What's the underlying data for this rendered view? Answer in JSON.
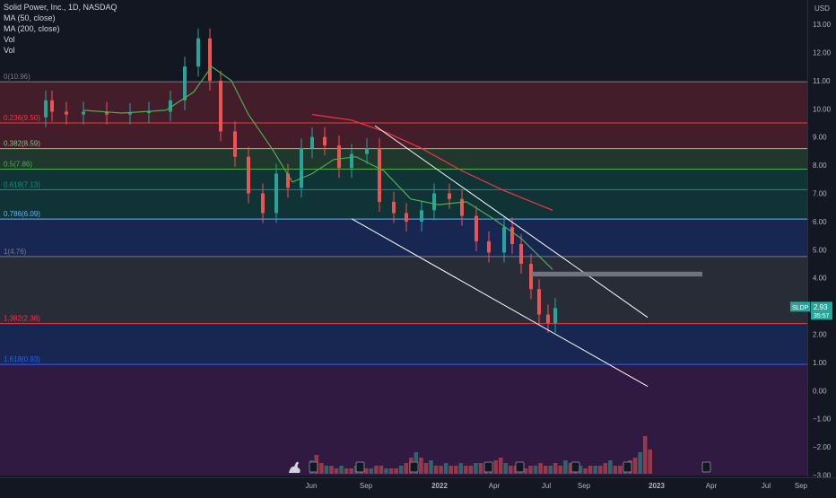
{
  "header": {
    "title": "Solid Power, Inc., 1D, NASDAQ",
    "indicators": [
      "MA (50, close)",
      "MA (200, close)",
      "Vol",
      "Vol"
    ]
  },
  "price_axis": {
    "unit": "USD",
    "ticks": [
      "13.00",
      "12.00",
      "11.00",
      "10.00",
      "9.00",
      "8.00",
      "7.00",
      "6.00",
      "5.00",
      "4.00",
      "3.00",
      "2.00",
      "1.00",
      "0.00",
      "−1.00",
      "−2.00",
      "−3.00"
    ]
  },
  "time_axis": {
    "ticks": [
      "Jun",
      "Sep",
      "2022",
      "Apr",
      "Jul",
      "Sep",
      "2023",
      "Apr",
      "Jul",
      "Sep"
    ]
  },
  "last_price": {
    "symbol": "SLDP",
    "price": "2.93",
    "countdown": "35:57"
  },
  "colors": {
    "background": "#131722",
    "up": "#26a69a",
    "down": "#ef5350",
    "ma50": "#4caf50",
    "ma200": "#f23645",
    "trendline": "#ffffff",
    "zone": "#787b86"
  },
  "chart_data": {
    "type": "candlestick",
    "y_range": [
      -3.3,
      13.7
    ],
    "x_range": [
      "2021-04-20",
      "2023-09-20"
    ],
    "fib_levels": [
      {
        "ratio": "0",
        "price": 10.96,
        "label": "0(10.96)",
        "color": "#787b86",
        "fill": "#f23645"
      },
      {
        "ratio": "0.236",
        "price": 9.5,
        "label": "0.236(9.50)",
        "color": "#f23645",
        "fill": "#f23645"
      },
      {
        "ratio": "0.382",
        "price": 8.59,
        "label": "0.382(8.59)",
        "color": "#81c784",
        "fill": "#4caf50"
      },
      {
        "ratio": "0.5",
        "price": 7.86,
        "label": "0.5(7.86)",
        "color": "#4caf50",
        "fill": "#089981"
      },
      {
        "ratio": "0.618",
        "price": 7.13,
        "label": "0.618(7.13)",
        "color": "#089981",
        "fill": "#089981"
      },
      {
        "ratio": "0.786",
        "price": 6.09,
        "label": "0.786(6.09)",
        "color": "#64b5f6",
        "fill": "#2962ff"
      },
      {
        "ratio": "1",
        "price": 4.76,
        "label": "1(4.76)",
        "color": "#787b86",
        "fill": "#787b86"
      },
      {
        "ratio": "1.382",
        "price": 2.38,
        "label": "1.382(2.38)",
        "color": "#f23645",
        "fill": "#2962ff"
      },
      {
        "ratio": "1.618",
        "price": 0.93,
        "label": "1.618(0.93)",
        "color": "#2962ff",
        "fill": "#9c27b0"
      }
    ],
    "price_series": [
      {
        "date": "2021-06-01",
        "close": 9.7
      },
      {
        "date": "2021-06-08",
        "close": 10.3
      },
      {
        "date": "2021-06-15",
        "close": 9.9
      },
      {
        "date": "2021-07-01",
        "close": 9.8
      },
      {
        "date": "2021-07-20",
        "close": 9.9
      },
      {
        "date": "2021-08-15",
        "close": 9.8
      },
      {
        "date": "2021-09-10",
        "close": 9.85
      },
      {
        "date": "2021-10-01",
        "close": 9.9
      },
      {
        "date": "2021-10-25",
        "close": 10.3
      },
      {
        "date": "2021-11-10",
        "close": 11.5
      },
      {
        "date": "2021-11-25",
        "close": 12.5
      },
      {
        "date": "2021-12-08",
        "close": 11.0
      },
      {
        "date": "2021-12-20",
        "close": 9.2
      },
      {
        "date": "2022-01-05",
        "close": 8.3
      },
      {
        "date": "2022-01-20",
        "close": 7.0
      },
      {
        "date": "2022-02-05",
        "close": 6.3
      },
      {
        "date": "2022-02-20",
        "close": 7.7
      },
      {
        "date": "2022-03-05",
        "close": 7.2
      },
      {
        "date": "2022-03-20",
        "close": 8.6
      },
      {
        "date": "2022-04-01",
        "close": 9.0
      },
      {
        "date": "2022-04-15",
        "close": 8.7
      },
      {
        "date": "2022-05-01",
        "close": 7.9
      },
      {
        "date": "2022-05-15",
        "close": 8.4
      },
      {
        "date": "2022-06-01",
        "close": 8.6
      },
      {
        "date": "2022-06-15",
        "close": 6.7
      },
      {
        "date": "2022-07-01",
        "close": 6.3
      },
      {
        "date": "2022-07-15",
        "close": 6.0
      },
      {
        "date": "2022-08-01",
        "close": 6.4
      },
      {
        "date": "2022-08-15",
        "close": 7.0
      },
      {
        "date": "2022-09-01",
        "close": 6.8
      },
      {
        "date": "2022-09-15",
        "close": 6.2
      },
      {
        "date": "2022-10-01",
        "close": 5.3
      },
      {
        "date": "2022-10-15",
        "close": 4.9
      },
      {
        "date": "2022-11-01",
        "close": 5.8
      },
      {
        "date": "2022-11-10",
        "close": 5.2
      },
      {
        "date": "2022-11-20",
        "close": 4.5
      },
      {
        "date": "2022-12-01",
        "close": 3.6
      },
      {
        "date": "2022-12-10",
        "close": 2.7
      },
      {
        "date": "2022-12-20",
        "close": 2.4
      },
      {
        "date": "2022-12-28",
        "close": 2.93
      }
    ],
    "ma50": [
      {
        "date": "2021-07-20",
        "value": 9.95
      },
      {
        "date": "2021-09-01",
        "value": 9.85
      },
      {
        "date": "2021-10-20",
        "value": 9.95
      },
      {
        "date": "2021-11-20",
        "value": 10.6
      },
      {
        "date": "2021-12-10",
        "value": 11.5
      },
      {
        "date": "2022-01-01",
        "value": 11.0
      },
      {
        "date": "2022-01-20",
        "value": 9.8
      },
      {
        "date": "2022-02-15",
        "value": 8.6
      },
      {
        "date": "2022-03-10",
        "value": 7.4
      },
      {
        "date": "2022-04-01",
        "value": 7.7
      },
      {
        "date": "2022-04-25",
        "value": 8.2
      },
      {
        "date": "2022-05-20",
        "value": 8.3
      },
      {
        "date": "2022-06-20",
        "value": 7.8
      },
      {
        "date": "2022-07-20",
        "value": 6.8
      },
      {
        "date": "2022-08-20",
        "value": 6.6
      },
      {
        "date": "2022-09-20",
        "value": 6.7
      },
      {
        "date": "2022-10-20",
        "value": 6.1
      },
      {
        "date": "2022-11-20",
        "value": 5.4
      },
      {
        "date": "2022-12-25",
        "value": 4.3
      }
    ],
    "ma200": [
      {
        "date": "2022-04-01",
        "value": 9.8
      },
      {
        "date": "2022-05-15",
        "value": 9.6
      },
      {
        "date": "2022-06-20",
        "value": 9.2
      },
      {
        "date": "2022-08-01",
        "value": 8.6
      },
      {
        "date": "2022-09-15",
        "value": 7.8
      },
      {
        "date": "2022-11-01",
        "value": 7.1
      },
      {
        "date": "2022-12-25",
        "value": 6.4
      }
    ],
    "channel": {
      "upper": [
        {
          "date": "2022-06-10",
          "price": 9.4
        },
        {
          "date": "2023-04-10",
          "price": 2.6
        }
      ],
      "lower": [
        {
          "date": "2022-05-15",
          "price": 6.1
        },
        {
          "date": "2023-04-10",
          "price": 0.15
        }
      ]
    },
    "resistance_zone": {
      "date_from": "2022-12-01",
      "date_to": "2023-06-10",
      "low": 4.05,
      "high": 4.22
    },
    "volume": [
      5,
      7,
      4,
      3,
      3,
      2,
      3,
      2,
      2,
      3,
      2,
      2,
      2,
      3,
      3,
      2,
      2,
      2,
      3,
      4,
      6,
      8,
      6,
      4,
      5,
      3,
      3,
      4,
      3,
      3,
      4,
      3,
      3,
      4,
      4,
      3,
      3,
      5,
      6,
      4,
      3,
      3,
      3,
      2,
      3,
      3,
      4,
      3,
      3,
      4,
      3,
      5,
      4,
      3,
      3,
      2,
      3,
      3,
      3,
      4,
      5,
      3,
      3,
      4,
      5,
      6,
      8,
      14,
      9
    ]
  }
}
